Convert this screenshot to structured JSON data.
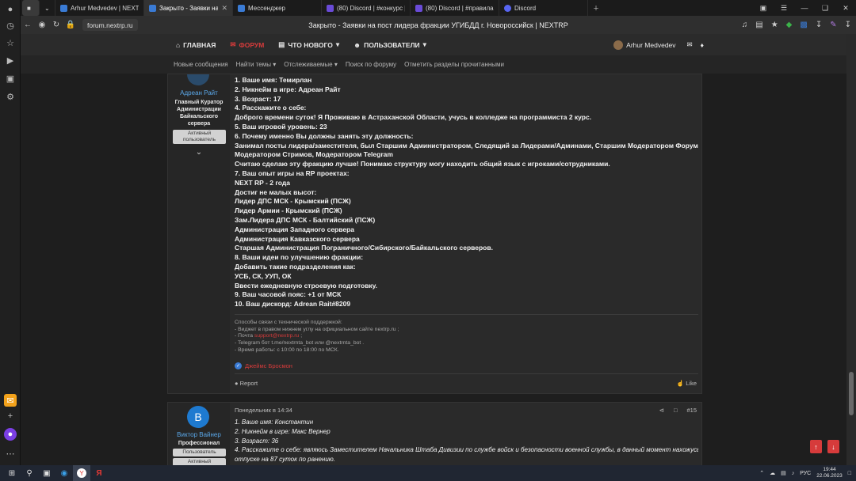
{
  "browser": {
    "tabs": [
      {
        "title": "Arhur Medvedev | NEXTRP",
        "color": "#3a7bd5",
        "active": false
      },
      {
        "title": "Закрыто - Заявки на п...",
        "color": "#3a7bd5",
        "active": true
      },
      {
        "title": "Мессенджер",
        "color": "#3a7bd5",
        "active": false
      },
      {
        "title": "(80) Discord | #конкурс | N",
        "color": "#6a4bd8",
        "active": false
      },
      {
        "title": "(80) Discord | #правила | P",
        "color": "#6a4bd8",
        "active": false
      },
      {
        "title": "Discord",
        "color": "#5865f2",
        "active": false
      }
    ],
    "url": "forum.nextrp.ru",
    "page_title": "Закрыто - Заявки на пост лидера фракции УГИБДД г. Новороссийск | NEXTRP"
  },
  "nav": {
    "home": "ГЛАВНАЯ",
    "forum": "ФОРУМ",
    "whats_new": "ЧТО НОВОГО",
    "users": "ПОЛЬЗОВАТЕЛИ",
    "username": "Arhur Medvedev"
  },
  "subnav": [
    "Новые сообщения",
    "Найти темы",
    "Отслеживаемые",
    "Поиск по форуму",
    "Отметить разделы прочитанными"
  ],
  "post1": {
    "author": "Адреан Райт",
    "role": [
      "Главный Куратор",
      "Администрации",
      "Байкальского",
      "сервера"
    ],
    "badge": [
      "Активный",
      "пользователь"
    ],
    "lines": [
      "1. Ваше имя: Темирлан",
      "2. Никнейм в игре: Адреан Райт",
      "3. Возраст: 17",
      "4. Расскажите о себе:",
      "Доброго времени суток! Я Проживаю в Астраханской Области, учусь в колледже на программиста 2 курс.",
      "5. Ваш игровой уровень: 23",
      "6. Почему именно Вы должны занять эту должность:",
      "Занимал посты лидера/заместителя, был Старшим Администратором, Следящий за Лидерами/Админами, Старшим Модератором Форума,",
      "Модератором Стримов, Модератором Telegram",
      "Считаю сделаю эту фракцию лучше! Понимаю структуру могу находить общий язык с игроками/сотрудниками.",
      "7. Ваш опыт игры на RP проектах:",
      "NEXT RP - 2 года",
      "Достиг не малых высот:",
      "Лидер ДПС МСК - Крымский (ПСЖ)",
      "Лидер Армии - Крымский (ПСЖ)",
      "Зам.Лидера ДПС МСК - Балтийский (ПСЖ)",
      "Администрация Западного сервера",
      "Администрация Кавказского сервера",
      "Старшая Администрация Пограничного/Сибирского/Байкальского серверов.",
      "8. Ваши идеи по улучшению фракции:",
      "Добавить такие подразделения как:",
      "УСБ, СК, УУП, ОК",
      "Ввести ежедневную строевую подготовку.",
      "9. Ваш часовой пояс: +1 от МСК",
      "10. Ваш дискорд: Adrean Rait#8209"
    ],
    "signature": {
      "line1": "Способы связи с технической поддержкой:",
      "line2": "- Виджет в правом нижнем углу на официальном сайте nextrp.ru ;",
      "line3_pre": "- Почта ",
      "line3_link": "support@nextrp.ru",
      "line3_post": " ;",
      "line4": "- Telegram бот t.me/nextrnta_bot или @nextrnta_bot .",
      "line5": "- Время работы: с 10:00 по 18:00 по МСК."
    },
    "liked_by": "Джеймс Бросмон",
    "report": "Report",
    "like": "Like"
  },
  "post2": {
    "avatar_letter": "В",
    "author": "Виктор Вайнер",
    "role": "Профессионал",
    "badge1": "Пользователь",
    "badge2": "Активный",
    "date": "Понедельник в 14:34",
    "number": "#15",
    "lines": [
      "1. Ваше имя: Константин",
      "2. Никнейм в игре: Макс Вернер",
      "3. Возраст: 36",
      "4. Расскажите о себе: являюсь Заместителем Начальника Штаба Дивизии по службе войск и безопасности военной службы, в данный момент нахожусь в",
      "отпуске на 87 суток по ранению."
    ]
  },
  "taskbar": {
    "lang": "РУС",
    "time": "19:44",
    "date": "22.06.2023"
  }
}
